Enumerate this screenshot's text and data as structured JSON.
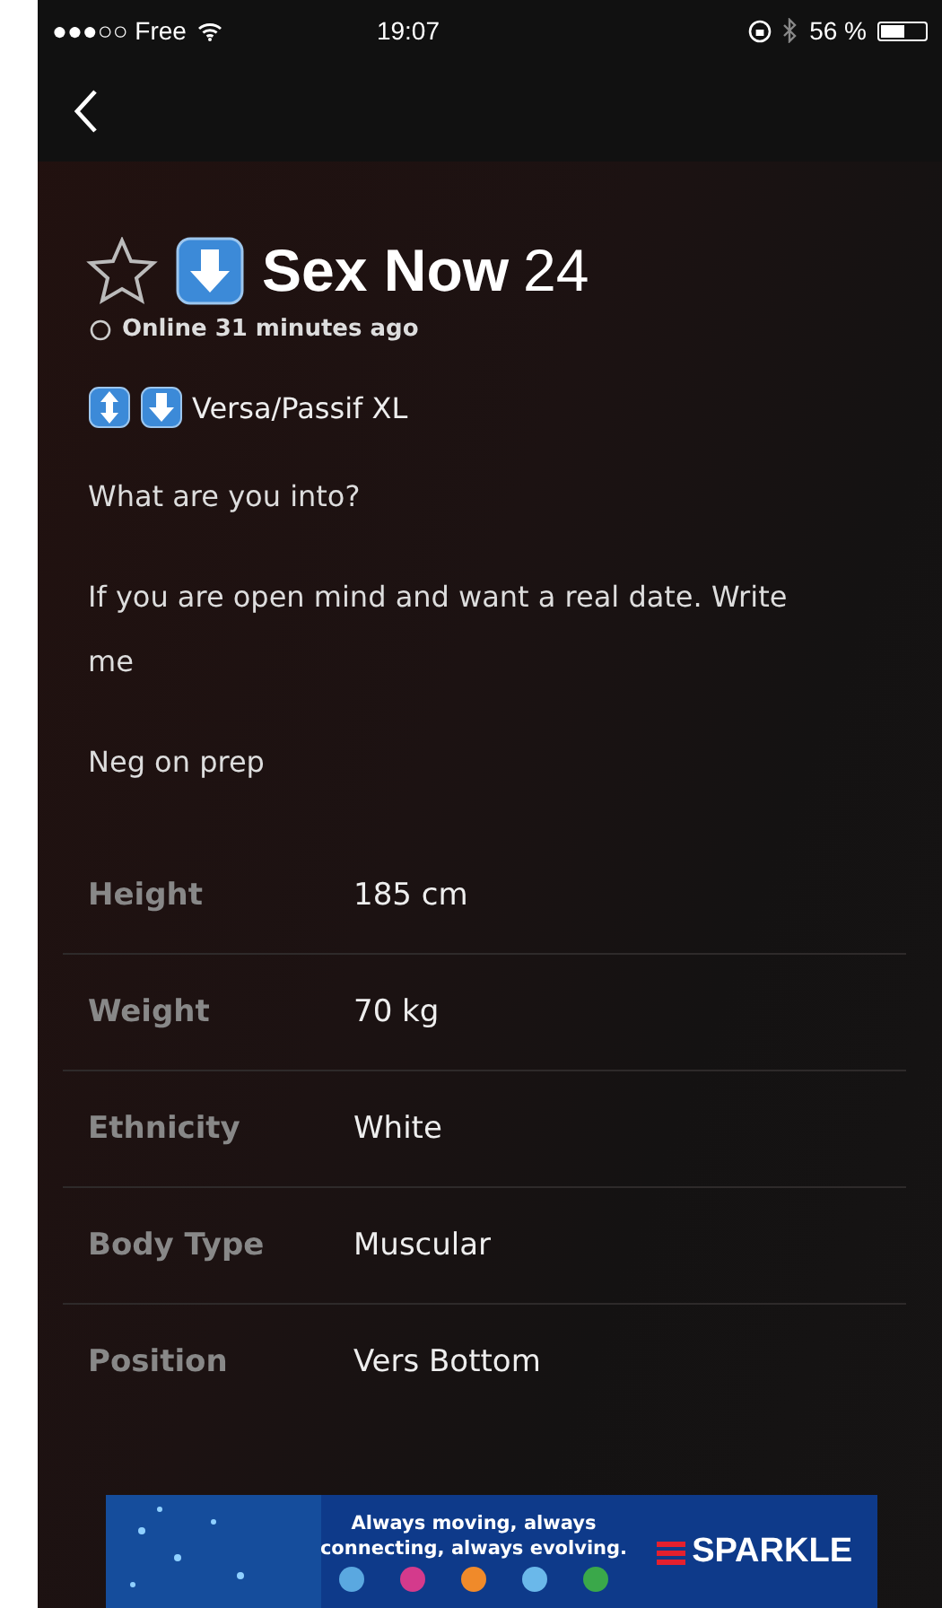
{
  "status_bar": {
    "carrier": "●●●○○ Free",
    "time": "19:07",
    "battery_text": "56 %"
  },
  "profile": {
    "favorite": false,
    "name": "Sex Now",
    "age": "24",
    "online": false,
    "last_seen": "Online 31 minutes ago",
    "role": "Versa/Passif XL",
    "paragraphs": [
      "What are you into?",
      "If you are open mind and want a real date. Write me",
      "Neg on prep"
    ]
  },
  "stats": [
    {
      "label": "Height",
      "value": "185 cm"
    },
    {
      "label": "Weight",
      "value": "70 kg"
    },
    {
      "label": "Ethnicity",
      "value": "White"
    },
    {
      "label": "Body Type",
      "value": "Muscular"
    },
    {
      "label": "Position",
      "value": "Vers Bottom"
    }
  ],
  "ad": {
    "headline": "Always moving, always connecting, always evolving.",
    "brand": "SPARKLE",
    "icons": [
      {
        "color": "#5aa8e0"
      },
      {
        "color": "#d43a8c"
      },
      {
        "color": "#f08a2a"
      },
      {
        "color": "#6ab8ea"
      },
      {
        "color": "#3aa84a"
      }
    ]
  }
}
